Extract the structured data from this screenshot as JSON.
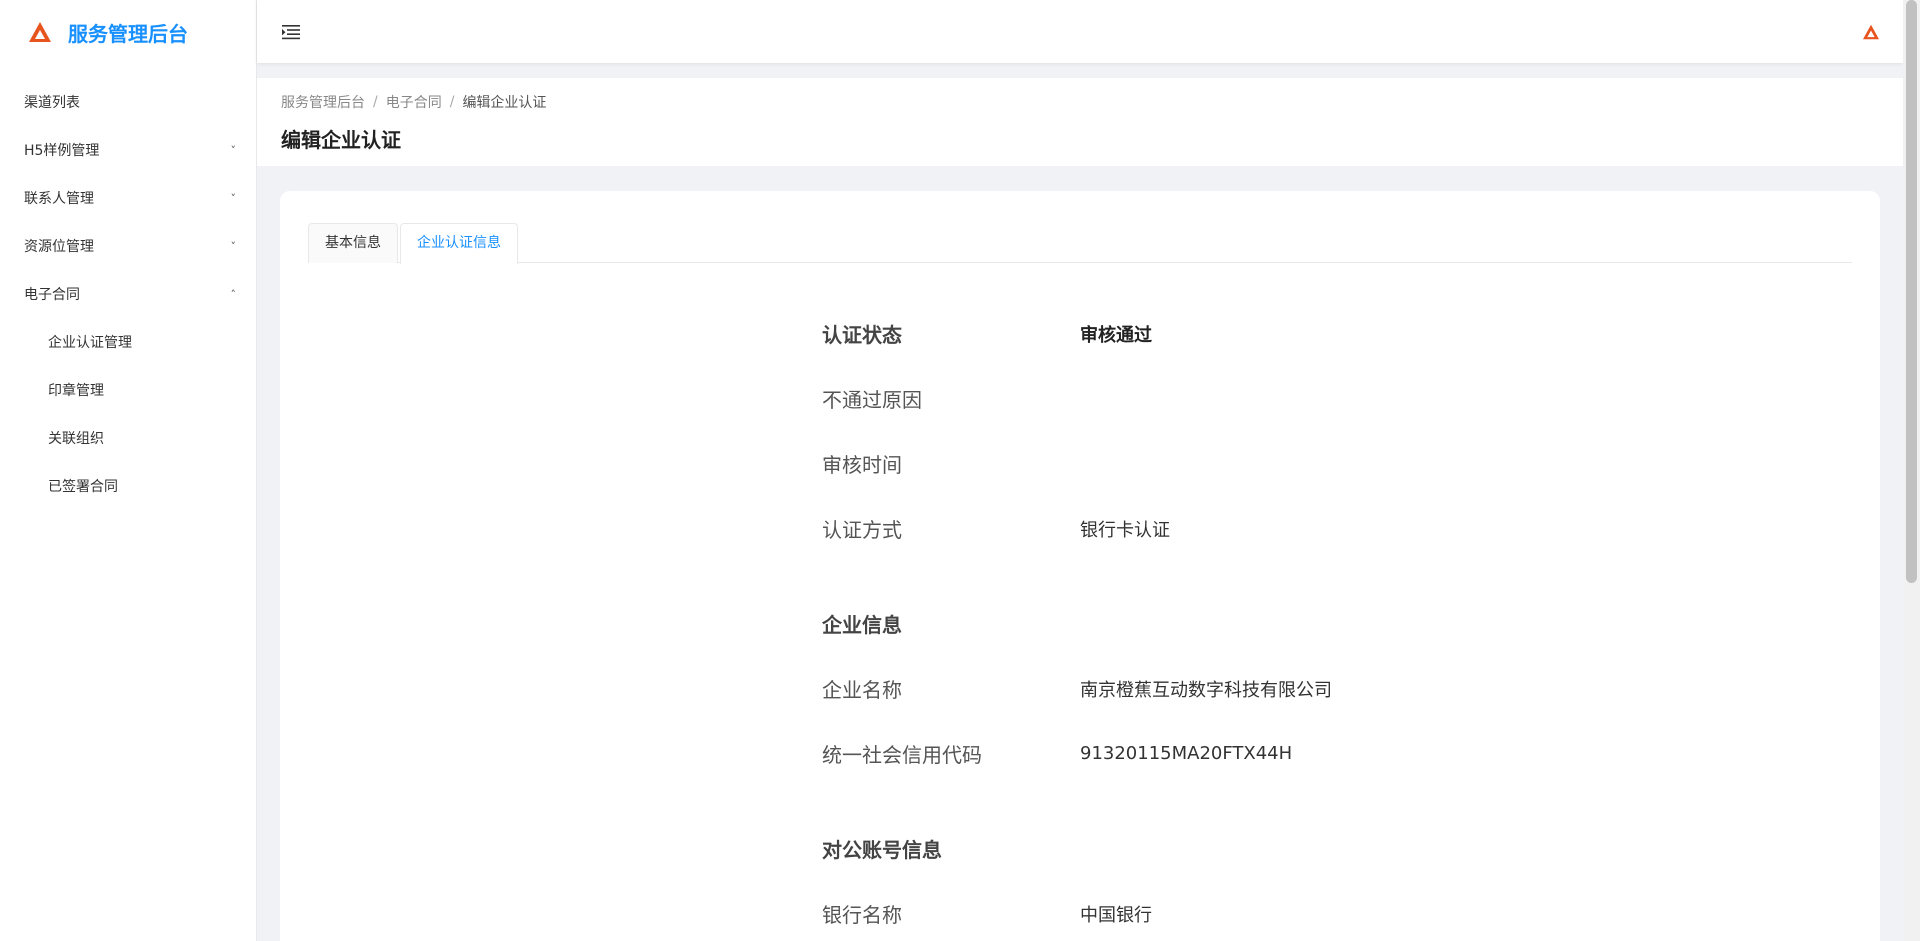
{
  "app": {
    "title": "服务管理后台"
  },
  "sidebar": {
    "items": [
      {
        "label": "渠道列表"
      },
      {
        "label": "H5样例管理",
        "chevron": "˅"
      },
      {
        "label": "联系人管理",
        "chevron": "˅"
      },
      {
        "label": "资源位管理",
        "chevron": "˅"
      },
      {
        "label": "电子合同",
        "chevron": "˄"
      }
    ],
    "submenu": [
      {
        "label": "企业认证管理"
      },
      {
        "label": "印章管理"
      },
      {
        "label": "关联组织"
      },
      {
        "label": "已签署合同"
      }
    ]
  },
  "breadcrumb": {
    "items": [
      "服务管理后台",
      "电子合同",
      "编辑企业认证"
    ],
    "separator": "/"
  },
  "page": {
    "title": "编辑企业认证"
  },
  "tabs": [
    {
      "label": "基本信息",
      "active": false
    },
    {
      "label": "企业认证信息",
      "active": true
    }
  ],
  "details": {
    "rows": [
      {
        "label": "认证状态",
        "value": "审核通过"
      },
      {
        "label": "不通过原因",
        "value": ""
      },
      {
        "label": "审核时间",
        "value": ""
      },
      {
        "label": "认证方式",
        "value": "银行卡认证"
      }
    ],
    "company_section": "企业信息",
    "company_rows": [
      {
        "label": "企业名称",
        "value": "南京橙蕉互动数字科技有限公司"
      },
      {
        "label": "统一社会信用代码",
        "value": "91320115MA20FTX44H"
      }
    ],
    "account_section": "对公账号信息",
    "account_rows": [
      {
        "label": "银行名称",
        "value": "中国银行"
      }
    ]
  },
  "colors": {
    "brand": "#1890ff",
    "logo": "#e8541e"
  },
  "icons": {
    "brand": "logo-icon",
    "menu_toggle": "menu-fold-icon",
    "header_logo": "logo-icon"
  }
}
